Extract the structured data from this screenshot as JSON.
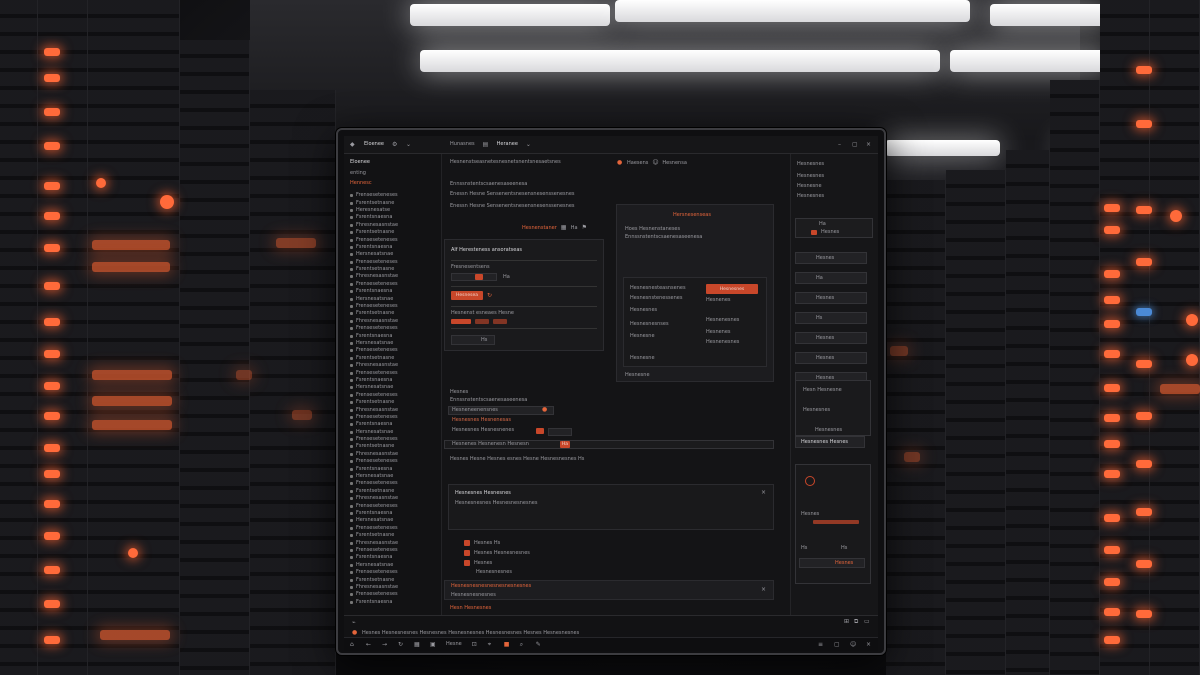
{
  "window": {
    "title": "Eloenee",
    "breadcrumb": "Hunasnes",
    "tab": "Heranee"
  },
  "sidebar": {
    "header": [
      "Eloenee",
      "enting",
      "Hennesc"
    ],
    "items": [
      "Frenseseteneses",
      "Fsrentsetnasne",
      "Heresnesatse",
      "Fsrentsnaesna",
      "Fhresnesasnstae",
      "Fsrentsetnasne",
      "Frenseseteneses",
      "Fsrentsnaesna",
      "Hersnesatsnae",
      "Frenseseteneses",
      "Fsrentsetnasne",
      "Fhresnesasnstae",
      "Frenseseteneses",
      "Fsrentsnaesna",
      "Hersnesatsnae",
      "Frenseseteneses",
      "Fsrentsetnasne",
      "Fhresnesasnstae",
      "Frenseseteneses",
      "Fsrentsnaesna",
      "Hersnesatsnae",
      "Frenseseteneses",
      "Fsrentsetnasne",
      "Fhresnesasnstae",
      "Frenseseteneses",
      "Fsrentsnaesna",
      "Hersnesatsnae",
      "Frenseseteneses",
      "Fsrentsetnasne",
      "Fhresnesasnstae",
      "Frenseseteneses",
      "Fsrentsnaesna",
      "Hersnesatsnae",
      "Frenseseteneses",
      "Fsrentsetnasne",
      "Fhresnesasnstae",
      "Frenseseteneses",
      "Fsrentsnaesna",
      "Hersnesatsnae",
      "Frenseseteneses",
      "Fsrentsetnasne",
      "Fhresnesasnstae",
      "Frenseseteneses",
      "Fsrentsnaesna",
      "Hersnesatsnae",
      "Frenseseteneses",
      "Fsrentsetnasne",
      "Fhresnesasnstae",
      "Frenseseteneses",
      "Fsrentsnaesna",
      "Hersnesatsnae",
      "Frenseseteneses",
      "Fsrentsetnasne",
      "Fhresnesasnstae",
      "Frenseseteneses",
      "Fsrentsnaesna"
    ]
  },
  "header": {
    "path": "Hesnenstseasnetesnesnetsnentsnesaetsnes",
    "actions": [
      "Haesens",
      "Hesnensa"
    ],
    "subline1": "Ennssnstentscsaenesaseenesa",
    "subline2": "Enessn  Hesne  Sensenentsnesensnesenssenesnes"
  },
  "editor": {
    "section_label": "Hesnenstaner",
    "zoom": "Ha",
    "title": "Alf Heresteness ansoratseas",
    "field1": "Fresnesentsens",
    "field1_val": "Ha",
    "button1": "Hesnesea",
    "row3": "Hesnenst esneaes  Hesne",
    "small_btn": "Hs"
  },
  "detail": {
    "title": "Hersnesenseas",
    "subtitle": "Hoes  Hesnenstaneses",
    "lines": [
      "Hesnesnesteasnsenes",
      "Hesnesnstenessenes",
      "Hesnesnes",
      "Hesnesnesnses",
      "Hesnesne"
    ],
    "cta": "Hesnesnes",
    "meta": [
      "Hesnenes",
      "Hesnenesnes"
    ],
    "footer": "Hesnesne"
  },
  "list": {
    "header": "Hesnes",
    "rows": [
      "Hesneneenensnes",
      "Hesnesnes   Hesnenesas",
      "Hesnesnes  Hesnesnenes"
    ],
    "buttons": [
      "Hesne",
      "Hesne"
    ]
  },
  "toolbar2": {
    "text": "Hesnenes  Hesnenesn  Hesnesn",
    "badge": "Ha"
  },
  "stats": {
    "line": "Hesnes  Hesne  Hesnes esnes  Hesne  Hesnesnesnes  Hs"
  },
  "card": {
    "title": "Hesnesnes  Hesnesnes",
    "sub": "Hesnesnesnes  Hesnesnesnesnes",
    "bullets": [
      "Hesnes  Hs",
      "Hesnes  Hesnesnesnes",
      "Hesnes",
      "Hesnesnesnes"
    ]
  },
  "notice": {
    "title": "Hesnesnesnesnesnesnesnesnes",
    "sub": "Hesnesnesnesnes"
  },
  "footer_link": "Hesn  Hesnesnes",
  "right": {
    "header": [
      "Hesnesnes",
      "Hesnesnes",
      "Hesnesne"
    ],
    "items": [
      "Hesnes",
      "Ha",
      "Hesnes",
      "Hs",
      "Hesnes",
      "Hesnes",
      "Hesnes"
    ],
    "note1": "Hesn  Hesnesne",
    "note2": "Hesnesnes",
    "note3": "Hesnesnes",
    "action": "Hesnesnes  Hesnes",
    "bottom": [
      "Hesnes",
      "Hs",
      "Hesnes"
    ]
  },
  "statusbar": {
    "text": "Hesnes  Hesnesnesnes  Hesnesnes  Hesnesnesnes  Hesnesnesnes  Hesnes  Hesnesnesnes",
    "tabs": [
      "Hesne"
    ]
  },
  "colors": {
    "accent": "#c8472a",
    "bg": "#121214"
  }
}
